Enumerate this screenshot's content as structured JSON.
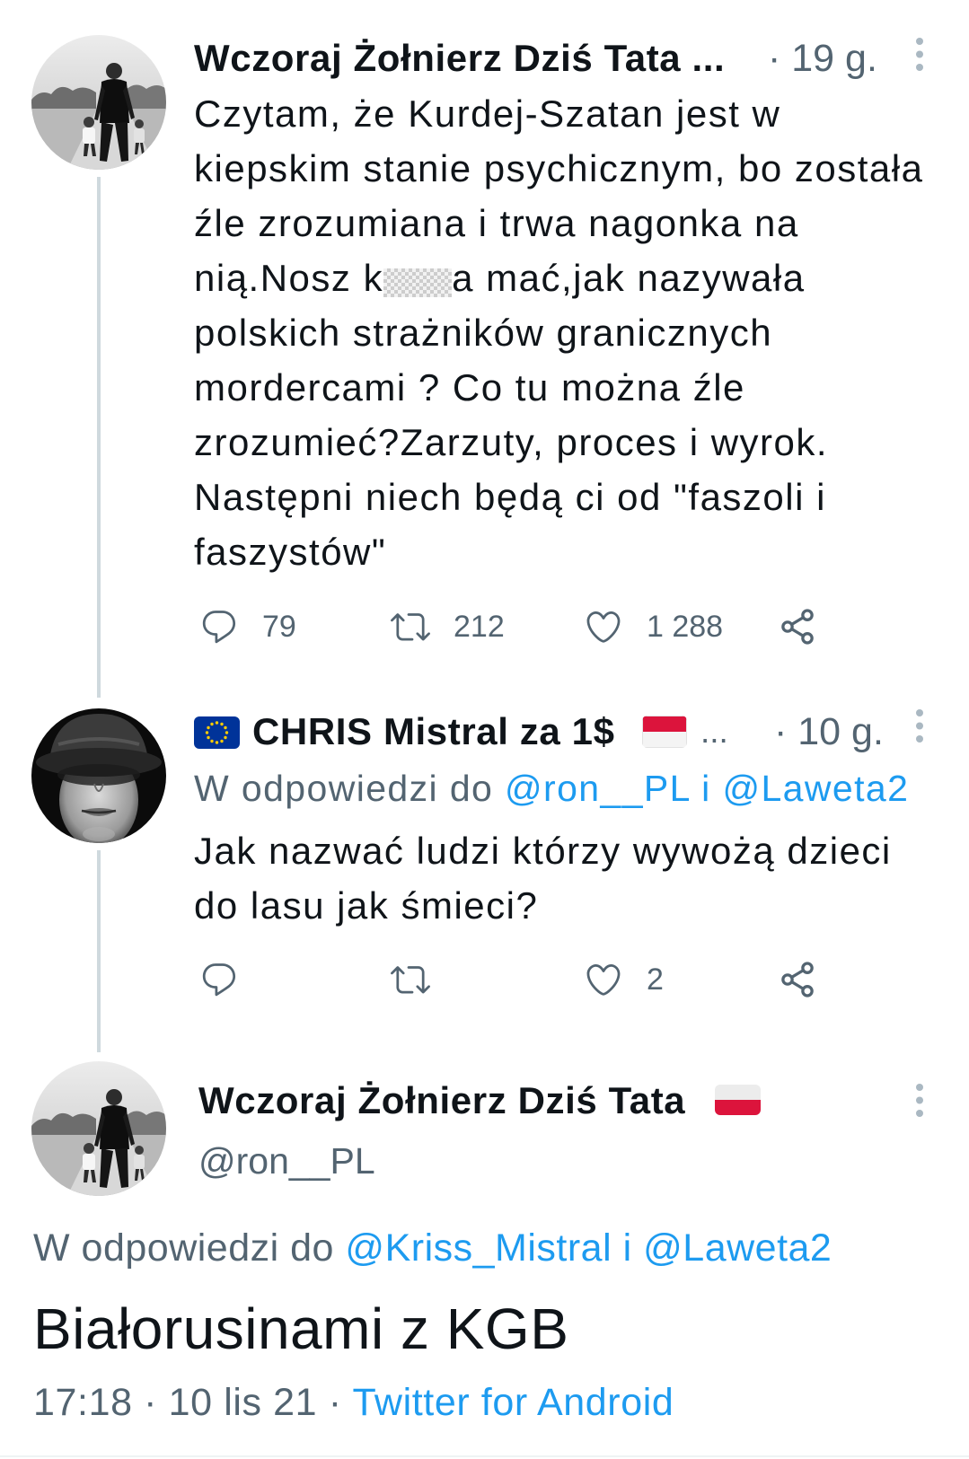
{
  "colors": {
    "text": "#0f1419",
    "secondary_text": "#536471",
    "link": "#1d9bf0",
    "thread_line": "#cfd9de",
    "icon": "#536471",
    "overflow_dots": "#aab8c2",
    "flag_red": "#dc143c",
    "eu_blue": "#003399",
    "eu_star": "#ffcc00"
  },
  "icons": {
    "reply": "reply-icon",
    "retweet": "retweet-icon",
    "like": "heart-icon",
    "share": "share-icon",
    "overflow": "more-vertical-icon"
  },
  "tweet1": {
    "author": "Wczoraj Żołnierz Dziś Tata ...",
    "time": "· 19 g.",
    "body": {
      "line1": "Czytam, że Kurdej-Szatan jest w",
      "line2": "kiepskim stanie psychicznym, bo została",
      "line3": "źle zrozumiana i trwa nagonka na",
      "line4_start": "nią.Nosz k",
      "line4_end": "a mać,jak nazywała",
      "line5": "polskich strażników granicznych",
      "line6": "mordercami ? Co tu można źle",
      "line7": "zrozumieć?Zarzuty, proces i wyrok.",
      "line8": "Następni niech będą ci od \"faszoli i",
      "line9": "faszystów\""
    },
    "stats": {
      "replies": "79",
      "retweets": "212",
      "likes": "1 288"
    }
  },
  "tweet2": {
    "badge_icon": "eu-flag-icon",
    "author": "CHRIS Mistral za 1$",
    "flag_icon": "red-white-flag-icon",
    "ellipsis": "...",
    "time": "· 10 g.",
    "reply_to": {
      "prefix": "W odpowiedzi do",
      "handle1": "@ron__PL",
      "conjunction": "i",
      "handle2": "@Laweta2"
    },
    "body": {
      "line1": "Jak nazwać ludzi którzy wywożą dzieci",
      "line2": "do lasu jak śmieci?"
    },
    "stats": {
      "likes": "2"
    }
  },
  "tweet3": {
    "author": "Wczoraj Żołnierz Dziś Tata",
    "flag_icon": "poland-flag-icon",
    "handle": "@ron__PL",
    "reply_to": {
      "prefix": "W odpowiedzi do",
      "handle1": "@Kriss_Mistral",
      "conjunction": "i",
      "handle2": "@Laweta2"
    },
    "text": "Białorusinami z KGB",
    "timestamp": "17:18 · 10 lis 21 ·",
    "source": "Twitter for Android"
  }
}
